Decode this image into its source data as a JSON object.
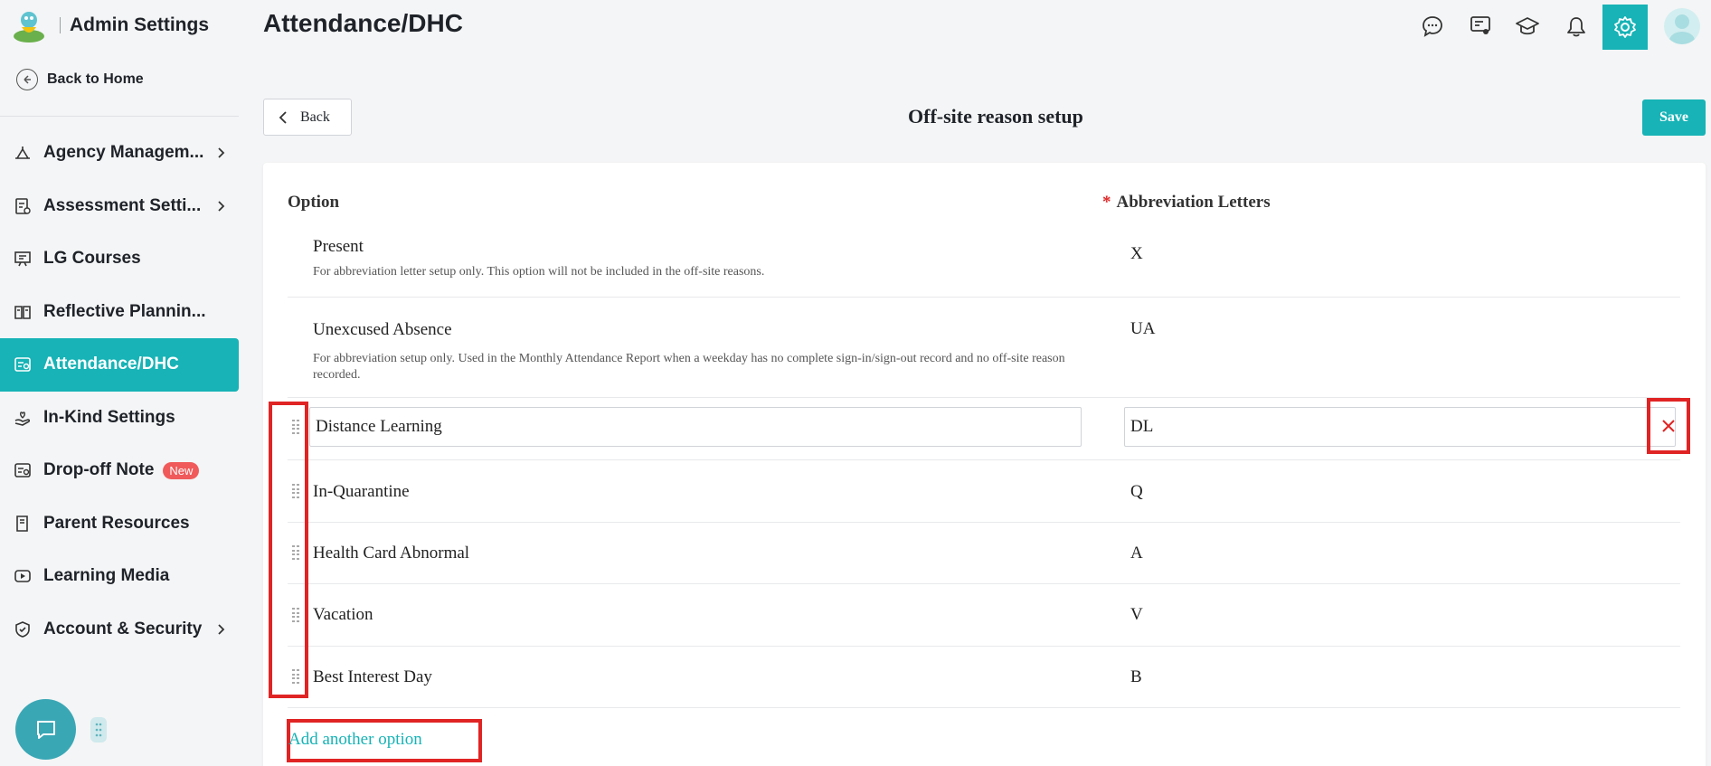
{
  "app": {
    "title": "Admin Settings"
  },
  "sidebar": {
    "back_home": "Back to Home",
    "items": [
      {
        "label": "Agency Managem...",
        "icon": "agency-icon",
        "has_arrow": true
      },
      {
        "label": "Assessment Setti...",
        "icon": "assessment-icon",
        "has_arrow": true
      },
      {
        "label": "LG Courses",
        "icon": "courses-icon",
        "has_arrow": false
      },
      {
        "label": "Reflective Plannin...",
        "icon": "planning-icon",
        "has_arrow": false
      },
      {
        "label": "Attendance/DHC",
        "icon": "attendance-icon",
        "has_arrow": false,
        "active": true
      },
      {
        "label": "In-Kind Settings",
        "icon": "inkind-icon",
        "has_arrow": false
      },
      {
        "label": "Drop-off Note",
        "icon": "dropoff-icon",
        "has_arrow": false,
        "badge": "New"
      },
      {
        "label": "Parent Resources",
        "icon": "resources-icon",
        "has_arrow": false
      },
      {
        "label": "Learning Media",
        "icon": "media-icon",
        "has_arrow": false
      },
      {
        "label": "Account & Security",
        "icon": "shield-icon",
        "has_arrow": true
      }
    ]
  },
  "header": {
    "title": "Attendance/DHC",
    "icons": [
      "chat-bubble-icon",
      "presentation-icon",
      "graduation-cap-icon",
      "bell-icon",
      "gear-icon",
      "user-avatar"
    ]
  },
  "subheader": {
    "back_label": "Back",
    "title": "Off-site reason setup",
    "save_label": "Save"
  },
  "table": {
    "col_option": "Option",
    "col_abbr": "Abbreviation Letters",
    "required_mark": "*",
    "fixed_rows": [
      {
        "name": "Present",
        "abbr": "X",
        "desc": "For abbreviation letter setup only. This option will not be included in the off-site reasons."
      },
      {
        "name": "Unexcused Absence",
        "abbr": "UA",
        "desc": "For abbreviation setup only. Used in the Monthly Attendance Report when a weekday has no complete sign-in/sign-out record and no off-site reason recorded."
      }
    ],
    "editing_row": {
      "name": "Distance Learning",
      "abbr": "DL"
    },
    "rows": [
      {
        "name": "In-Quarantine",
        "abbr": "Q"
      },
      {
        "name": "Health Card Abnormal",
        "abbr": "A"
      },
      {
        "name": "Vacation",
        "abbr": "V"
      },
      {
        "name": "Best Interest Day",
        "abbr": "B"
      }
    ],
    "add_option": "Add another option"
  },
  "colors": {
    "accent": "#17b3b6",
    "highlight": "#e02424",
    "badge": "#f05a5a"
  }
}
